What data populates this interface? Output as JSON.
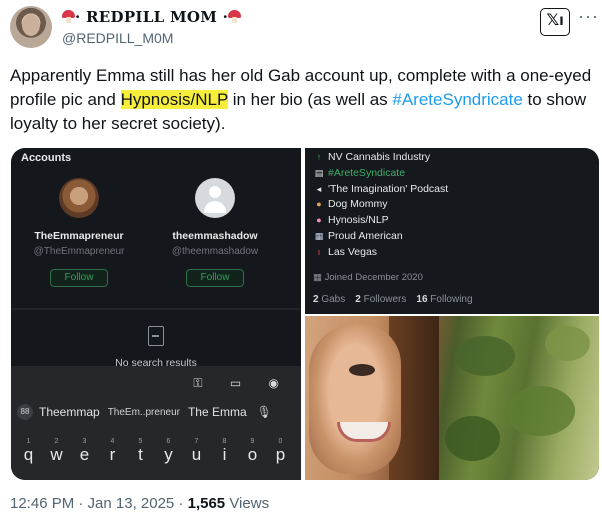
{
  "header": {
    "display_name": "· REDPILL MOM ·",
    "handle": "@REDPILL_M0M",
    "xi_label": "𝕏ı",
    "more": "···"
  },
  "tweet": {
    "text_1": "Apparently Emma still has her old Gab account up, complete with a one-eyed profile pic and ",
    "highlight": "Hypnosis/NLP",
    "text_2": " in her bio (as well as ",
    "hashtag": "#AreteSyndricate",
    "text_3": " to show  loyalty to her secret society)."
  },
  "accounts_panel": {
    "title": "Accounts",
    "cards": [
      {
        "name": "TheEmmapreneur",
        "handle": "@TheEmmapreneur",
        "button": "Follow"
      },
      {
        "name": "theemmashadow",
        "handle": "@theemmashadow",
        "button": "Follow"
      }
    ],
    "no_results": "No search results"
  },
  "keyboard": {
    "tools": "⚿ ▭ ◉",
    "grid_icon": "88",
    "suggestions": [
      "Theemmap",
      "TheEm..preneur",
      "The Emma"
    ],
    "mic": "🎙",
    "keys": [
      {
        "k": "q",
        "n": "1"
      },
      {
        "k": "w",
        "n": "2"
      },
      {
        "k": "e",
        "n": "3"
      },
      {
        "k": "r",
        "n": "4"
      },
      {
        "k": "t",
        "n": "5"
      },
      {
        "k": "y",
        "n": "6"
      },
      {
        "k": "u",
        "n": "7"
      },
      {
        "k": "i",
        "n": "8"
      },
      {
        "k": "o",
        "n": "9"
      },
      {
        "k": "p",
        "n": "0"
      }
    ]
  },
  "profile": {
    "bio": [
      {
        "icon": "↑",
        "text": "NV Cannabis Industry"
      },
      {
        "icon": "▤",
        "text": "#AreteSyndicate"
      },
      {
        "icon": "◂",
        "text": "'The Imagination' Podcast"
      },
      {
        "icon": "●",
        "text": "Dog Mommy"
      },
      {
        "icon": "●",
        "text": "Hynosis/NLP"
      },
      {
        "icon": "▦",
        "text": "Proud American"
      },
      {
        "icon": "ı",
        "text": "Las Vegas"
      }
    ],
    "joined": "Joined December 2020",
    "gabs_count": "2",
    "gabs_label": "Gabs",
    "followers_count": "2",
    "followers_label": "Followers",
    "following_count": "16",
    "following_label": "Following"
  },
  "footer": {
    "time": "12:46 PM · Jan 13, 2025 · ",
    "views_count": "1,565",
    "views_label": " Views"
  }
}
